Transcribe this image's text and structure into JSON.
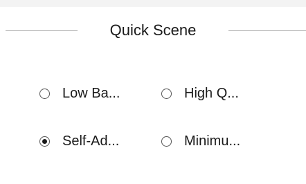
{
  "group": {
    "title": "Quick Scene"
  },
  "options": [
    {
      "label": "Low Ba...",
      "selected": false
    },
    {
      "label": "High Q...",
      "selected": false
    },
    {
      "label": "Self-Ad...",
      "selected": true
    },
    {
      "label": "Minimu...",
      "selected": false
    }
  ]
}
